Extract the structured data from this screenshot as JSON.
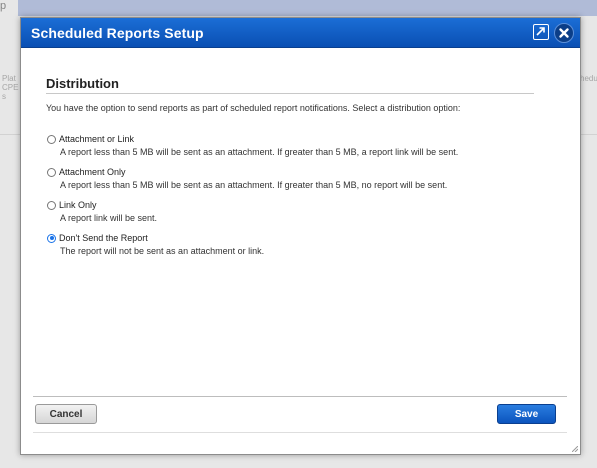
{
  "background": {
    "top_left_text": "p",
    "left_text_lines": [
      "Plat",
      "CPE",
      "s"
    ],
    "right_text": "hedu"
  },
  "dialog": {
    "title": "Scheduled Reports Setup",
    "expand_icon": "expand-icon",
    "close_icon": "close-icon",
    "section_title": "Distribution",
    "intro": "You have the option to send reports as part of scheduled report notifications. Select a distribution option:",
    "options": [
      {
        "label": "Attachment or Link",
        "description": "A report less than 5 MB will be sent as an attachment. If greater than 5 MB, a report link will be sent.",
        "checked": false
      },
      {
        "label": "Attachment Only",
        "description": "A report less than 5 MB will be sent as an attachment. If greater than 5 MB, no report will be sent.",
        "checked": false
      },
      {
        "label": "Link Only",
        "description": "A report link will be sent.",
        "checked": false
      },
      {
        "label": "Don't Send the Report",
        "description": "The report will not be sent as an attachment or link.",
        "checked": true
      }
    ],
    "cancel_label": "Cancel",
    "save_label": "Save"
  },
  "colors": {
    "header": "#0f5fc8",
    "save_button": "#0b54bd",
    "radio_selected": "#1a73e8"
  }
}
